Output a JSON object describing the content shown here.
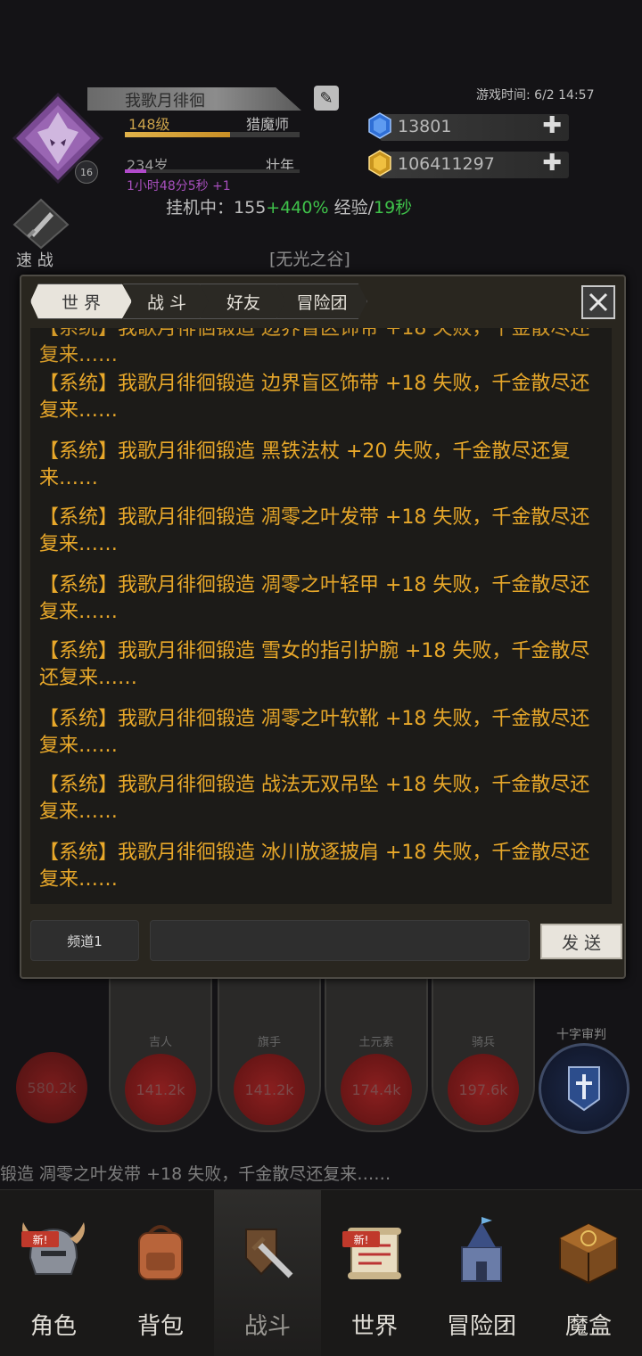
{
  "header": {
    "player_name": "我歌月徘徊",
    "game_time": "游戏时间: 6/2 14:57",
    "level": "148级",
    "class": "猎魔师",
    "avatar_badge": "16",
    "age": "234岁",
    "life_stage": "壮年",
    "age_timer": "1小时48分5秒 +1",
    "idle_status": {
      "label": "挂机中：",
      "value": "155",
      "bonus": "+440%",
      "unit_label": "经验/",
      "interval": "19秒"
    },
    "exp_progress": 0.6,
    "age_progress": 0.12
  },
  "currency": {
    "gems": "13801",
    "gold": "106411297"
  },
  "quick_battle": {
    "label": "速 战"
  },
  "location": {
    "title": "[无光之谷]"
  },
  "chat": {
    "tabs": [
      "世 界",
      "战 斗",
      "好友",
      "冒险团"
    ],
    "active_tab": 0,
    "messages": [
      "【系统】我歌月徘徊锻造 边界盲区饰带 +18 失败，千金散尽还复来……",
      "【系统】我歌月徘徊锻造 黑铁法杖 +20 失败，千金散尽还复来……",
      "【系统】我歌月徘徊锻造 凋零之叶发带 +18 失败，千金散尽还复来……",
      "【系统】我歌月徘徊锻造 凋零之叶轻甲 +18 失败，千金散尽还复来……",
      "【系统】我歌月徘徊锻造 雪女的指引护腕 +18 失败，千金散尽还复来……",
      "【系统】我歌月徘徊锻造 凋零之叶软靴 +18 失败，千金散尽还复来……",
      "【系统】我歌月徘徊锻造 战法无双吊坠 +18 失败，千金散尽还复来……",
      "【系统】我歌月徘徊锻造 冰川放逐披肩 +18 失败，千金散尽还复来……"
    ],
    "channel_label": "频道1",
    "input_value": "",
    "send_label": "发 送"
  },
  "background": {
    "units": [
      {
        "name": "吉人",
        "power": "141.2k"
      },
      {
        "name": "旗手",
        "power": "141.2k"
      },
      {
        "name": "土元素",
        "power": "174.4k"
      },
      {
        "name": "骑兵",
        "power": "197.6k"
      }
    ],
    "hero_power": "580.2k",
    "crusade_label": "十字审判",
    "ticker": "锻造 凋零之叶发带 +18 失败，千金散尽还复来……"
  },
  "nav": {
    "items": [
      "角色",
      "背包",
      "战斗",
      "世界",
      "冒险团",
      "魔盒"
    ],
    "active": 2,
    "new_badge": "新!"
  },
  "colors": {
    "message_text": "#e8a82a",
    "idle_bonus": "#3fc24a",
    "age_accent": "#a74fbd"
  }
}
